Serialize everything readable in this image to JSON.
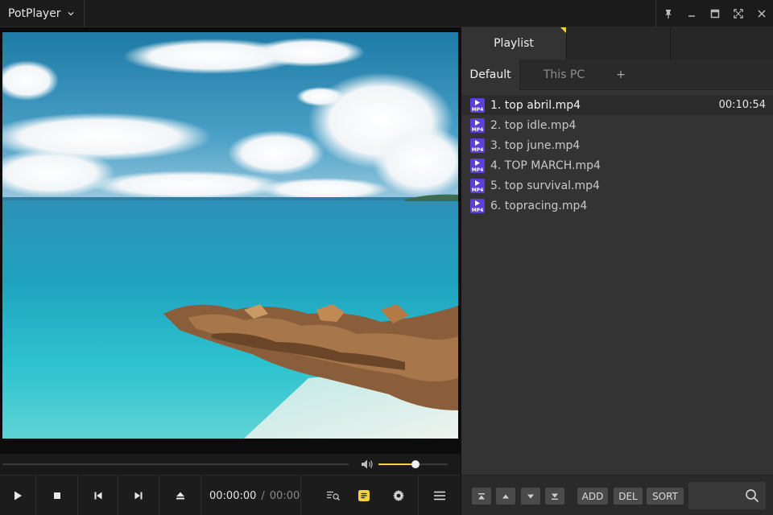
{
  "app": {
    "title": "PotPlayer"
  },
  "player": {
    "time_current": "00:00:00",
    "time_separator": "/",
    "time_total": "00:00:",
    "volume_fraction": 0.53,
    "seek_fraction": 0
  },
  "playlist": {
    "main_tabs": [
      "Playlist",
      "",
      ""
    ],
    "sub_tabs": {
      "default": "Default",
      "this_pc": "This PC",
      "add": "+"
    },
    "items": [
      {
        "title": "1. top abril.mp4",
        "duration": "00:10:54",
        "icon": "mp4-file-icon",
        "selected": true
      },
      {
        "title": "2. top idle.mp4",
        "duration": "",
        "icon": "mp4-file-icon",
        "selected": false
      },
      {
        "title": "3. top june.mp4",
        "duration": "",
        "icon": "mp4-file-icon",
        "selected": false
      },
      {
        "title": "4. TOP MARCH.mp4",
        "duration": "",
        "icon": "mp4-file-icon",
        "selected": false
      },
      {
        "title": "5. top survival.mp4",
        "duration": "",
        "icon": "mp4-file-icon",
        "selected": false
      },
      {
        "title": "6. topracing.mp4",
        "duration": "",
        "icon": "mp4-file-icon",
        "selected": false
      }
    ],
    "toolbar": {
      "add_label": "ADD",
      "del_label": "DEL",
      "sort_label": "SORT",
      "search_placeholder": ""
    }
  },
  "colors": {
    "accent": "#f2d33a",
    "icon_badge": "#5b3fd6"
  }
}
